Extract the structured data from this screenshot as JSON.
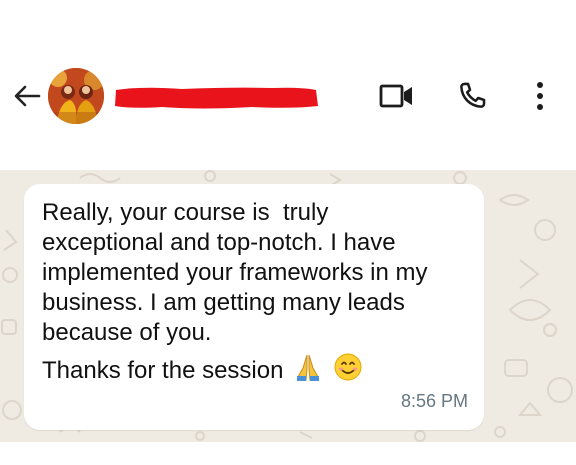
{
  "header": {
    "icons": {
      "back": "arrow-left-icon",
      "video": "video-camera-icon",
      "call": "phone-icon",
      "more": "more-vertical-icon"
    }
  },
  "message": {
    "text": "Really, your course is  truly\nexceptional and top-notch. I have\nimplemented your frameworks in my\nbusiness. I am getting many leads\nbecause of you.",
    "thanks": "Thanks for the session",
    "time": "8:56 PM"
  },
  "colors": {
    "chat_background": "#efeae2",
    "bubble": "#ffffff",
    "timestamp": "#667781",
    "redaction": "#e8131b"
  }
}
